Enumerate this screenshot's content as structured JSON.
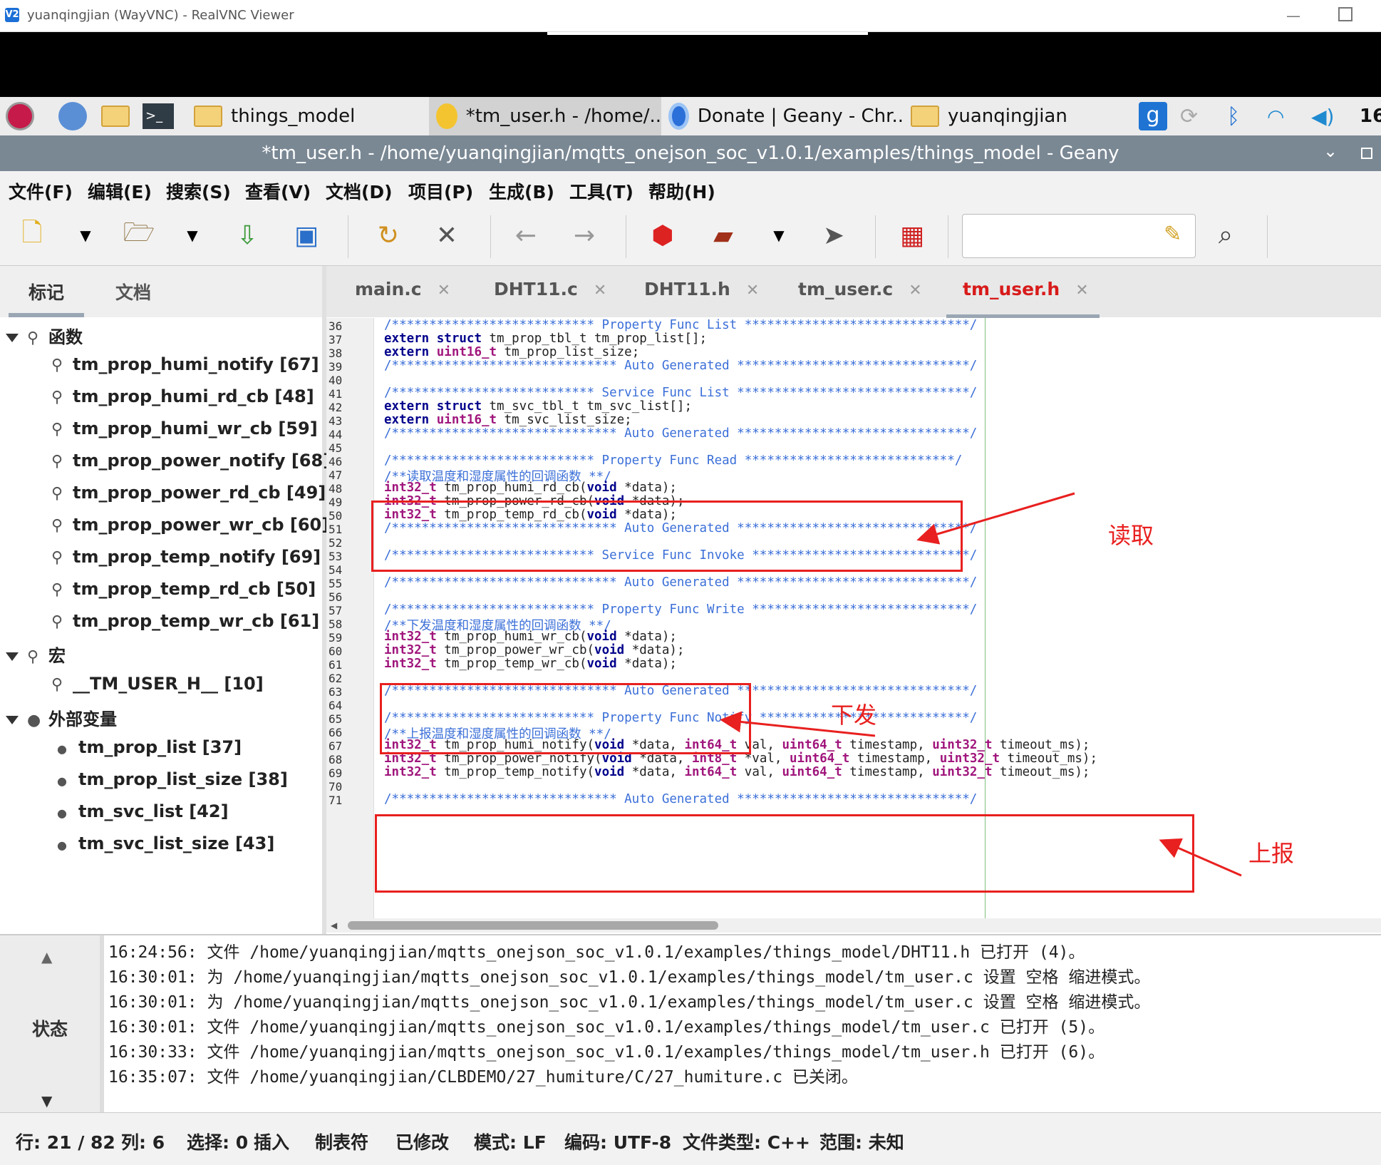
{
  "vnc": {
    "title": "yuanqingjian (WayVNC) - RealVNC Viewer",
    "logo": "V2"
  },
  "taskbar": {
    "items": [
      {
        "label": "things_model"
      },
      {
        "label": "*tm_user.h - /home/.."
      },
      {
        "label": "Donate | Geany - Chr.."
      },
      {
        "label": "yuanqingjian"
      }
    ],
    "clock": "16"
  },
  "window": {
    "title": "*tm_user.h - /home/yuanqingjian/mqtts_onejson_soc_v1.0.1/examples/things_model - Geany"
  },
  "menubar": [
    "文件(F)",
    "编辑(E)",
    "搜索(S)",
    "查看(V)",
    "文档(D)",
    "项目(P)",
    "生成(B)",
    "工具(T)",
    "帮助(H)"
  ],
  "sidebar": {
    "tabs": [
      "标记",
      "文档"
    ],
    "categories": [
      {
        "label": "函数",
        "items": [
          "tm_prop_humi_notify [67]",
          "tm_prop_humi_rd_cb [48]",
          "tm_prop_humi_wr_cb [59]",
          "tm_prop_power_notify [68]",
          "tm_prop_power_rd_cb [49]",
          "tm_prop_power_wr_cb [60]",
          "tm_prop_temp_notify [69]",
          "tm_prop_temp_rd_cb [50]",
          "tm_prop_temp_wr_cb [61]"
        ]
      },
      {
        "label": "宏",
        "items": [
          "__TM_USER_H__ [10]"
        ]
      },
      {
        "label": "外部变量",
        "items": [
          "tm_prop_list [37]",
          "tm_prop_list_size [38]",
          "tm_svc_list [42]",
          "tm_svc_list_size [43]"
        ]
      }
    ]
  },
  "editor": {
    "tabs": [
      {
        "label": "main.c",
        "active": false
      },
      {
        "label": "DHT11.c",
        "active": false
      },
      {
        "label": "DHT11.h",
        "active": false
      },
      {
        "label": "tm_user.c",
        "active": false
      },
      {
        "label": "tm_user.h",
        "active": true
      }
    ],
    "line_numbers": [
      "36",
      "37",
      "38",
      "39",
      "40",
      "41",
      "42",
      "43",
      "44",
      "45",
      "46",
      "47",
      "48",
      "49",
      "50",
      "51",
      "52",
      "53",
      "54",
      "55",
      "56",
      "57",
      "58",
      "59",
      "60",
      "61",
      "62",
      "63",
      "64",
      "65",
      "66",
      "67",
      "68",
      "69",
      "70",
      "71"
    ],
    "lines": [
      "/*************************** Property Func List ******************************/",
      "extern struct tm_prop_tbl_t tm_prop_list[];",
      "extern uint16_t tm_prop_list_size;",
      "/****************************** Auto Generated *******************************/",
      "",
      "/*************************** Service Func List *******************************/",
      "extern struct tm_svc_tbl_t tm_svc_list[];",
      "extern uint16_t tm_svc_list_size;",
      "/****************************** Auto Generated *******************************/",
      "",
      "/*************************** Property Func Read ****************************/",
      "/**读取温度和湿度属性的回调函数 **/",
      "int32_t tm_prop_humi_rd_cb(void *data);",
      "int32_t tm_prop_power_rd_cb(void *data);",
      "int32_t tm_prop_temp_rd_cb(void *data);",
      "/****************************** Auto Generated *******************************/",
      "",
      "/*************************** Service Func Invoke *****************************/",
      "",
      "/****************************** Auto Generated *******************************/",
      "",
      "/*************************** Property Func Write *****************************/",
      "/**下发温度和湿度属性的回调函数 **/",
      "int32_t tm_prop_humi_wr_cb(void *data);",
      "int32_t tm_prop_power_wr_cb(void *data);",
      "int32_t tm_prop_temp_wr_cb(void *data);",
      "",
      "/****************************** Auto Generated *******************************/",
      "",
      "/*************************** Property Func Notify ****************************/",
      "/**上报温度和湿度属性的回调函数 **/",
      "int32_t tm_prop_humi_notify(void *data, int64_t val, uint64_t timestamp, uint32_t timeout_ms);",
      "int32_t tm_prop_power_notify(void *data, int8_t *val, uint64_t timestamp, uint32_t timeout_ms);",
      "int32_t tm_prop_temp_notify(void *data, int64_t val, uint64_t timestamp, uint32_t timeout_ms);",
      "",
      "/****************************** Auto Generated *******************************/"
    ]
  },
  "annotations": {
    "read": "读取",
    "write": "下发",
    "report": "上报"
  },
  "messages": {
    "label": "状态",
    "lines": [
      "16:24:56: 文件 /home/yuanqingjian/mqtts_onejson_soc_v1.0.1/examples/things_model/DHT11.h 已打开 (4)。",
      "16:30:01: 为 /home/yuanqingjian/mqtts_onejson_soc_v1.0.1/examples/things_model/tm_user.c 设置 空格 缩进模式。",
      "16:30:01: 为 /home/yuanqingjian/mqtts_onejson_soc_v1.0.1/examples/things_model/tm_user.c 设置 空格 缩进模式。",
      "16:30:01: 文件 /home/yuanqingjian/mqtts_onejson_soc_v1.0.1/examples/things_model/tm_user.c 已打开 (5)。",
      "16:30:33: 文件 /home/yuanqingjian/mqtts_onejson_soc_v1.0.1/examples/things_model/tm_user.h 已打开 (6)。",
      "16:35:07: 文件 /home/yuanqingjian/CLBDEMO/27_humiture/C/27_humiture.c 已关闭。"
    ]
  },
  "status": {
    "line": "行: 21 / 82",
    "col": "列: 6",
    "sel": "选择: 0",
    "mode": "插入",
    "indent": "制表符",
    "modified": "已修改",
    "eol": "模式: LF",
    "enc": "编码: UTF-8",
    "ftype": "文件类型: C++",
    "scope": "范围: 未知"
  },
  "colors": {
    "annotation": "#e8201f",
    "title_bar": "#7a8894",
    "active_tab": "#d81b1b"
  }
}
